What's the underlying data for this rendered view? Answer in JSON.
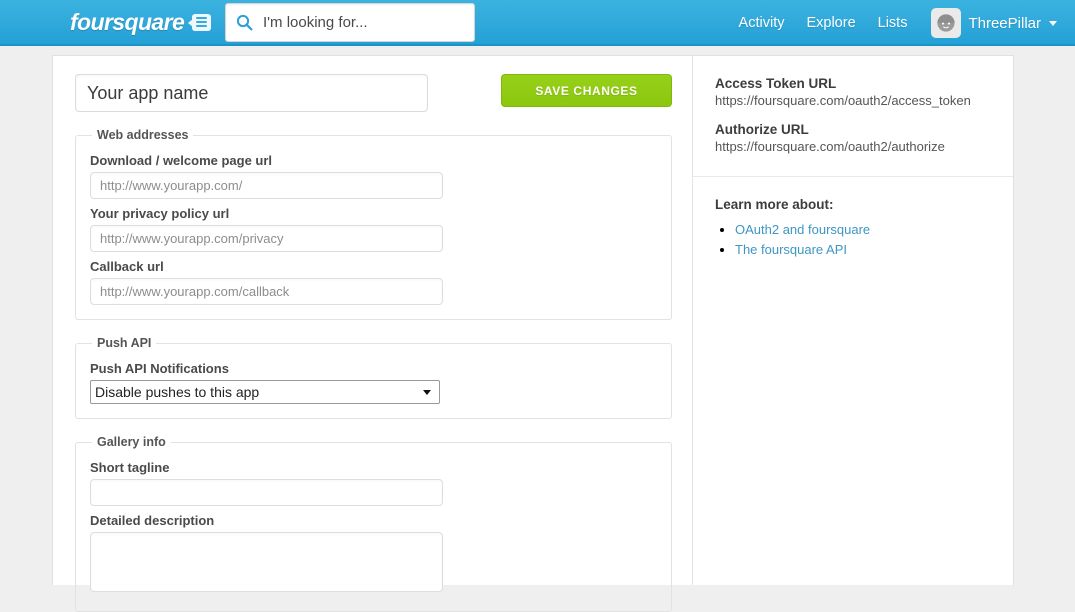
{
  "topbar": {
    "brand": "foursquare",
    "brand_icon": "speech-bubble-menu-icon",
    "search": {
      "icon": "search-icon",
      "placeholder": "I'm looking for...",
      "value": ""
    },
    "links": [
      {
        "label": "Activity"
      },
      {
        "label": "Explore"
      },
      {
        "label": "Lists"
      }
    ],
    "user": {
      "name": "ThreePillar",
      "avatar_icon": "avatar-icon",
      "caret_icon": "chevron-down-icon"
    },
    "colors": {
      "bar_top": "#3bb3e0",
      "bar_bottom": "#23a1d6",
      "border": "#1b93c9"
    }
  },
  "form": {
    "app_name": {
      "placeholder": "Your app name",
      "value": ""
    },
    "save_button": "SAVE CHANGES",
    "save_color": "#8bc70f",
    "sections": [
      {
        "legend": "Web addresses",
        "fields": [
          {
            "label": "Download / welcome page url",
            "placeholder": "http://www.yourapp.com/",
            "value": ""
          },
          {
            "label": "Your privacy policy url",
            "placeholder": "http://www.yourapp.com/privacy",
            "value": ""
          },
          {
            "label": "Callback url",
            "placeholder": "http://www.yourapp.com/callback",
            "value": ""
          }
        ]
      },
      {
        "legend": "Push API",
        "select_label": "Push API Notifications",
        "select_value": "Disable pushes to this app",
        "select_options": [
          "Disable pushes to this app"
        ]
      },
      {
        "legend": "Gallery info",
        "tagline_label": "Short tagline",
        "tagline_value": "",
        "description_label": "Detailed description",
        "description_value": ""
      }
    ]
  },
  "sidebar": {
    "oauth": [
      {
        "title": "Access Token URL",
        "value": "https://foursquare.com/oauth2/access_token"
      },
      {
        "title": "Authorize URL",
        "value": "https://foursquare.com/oauth2/authorize"
      }
    ],
    "learn_heading": "Learn more about:",
    "links": [
      {
        "label": "OAuth2 and foursquare"
      },
      {
        "label": "The foursquare API"
      }
    ],
    "link_color": "#3d97c4"
  }
}
